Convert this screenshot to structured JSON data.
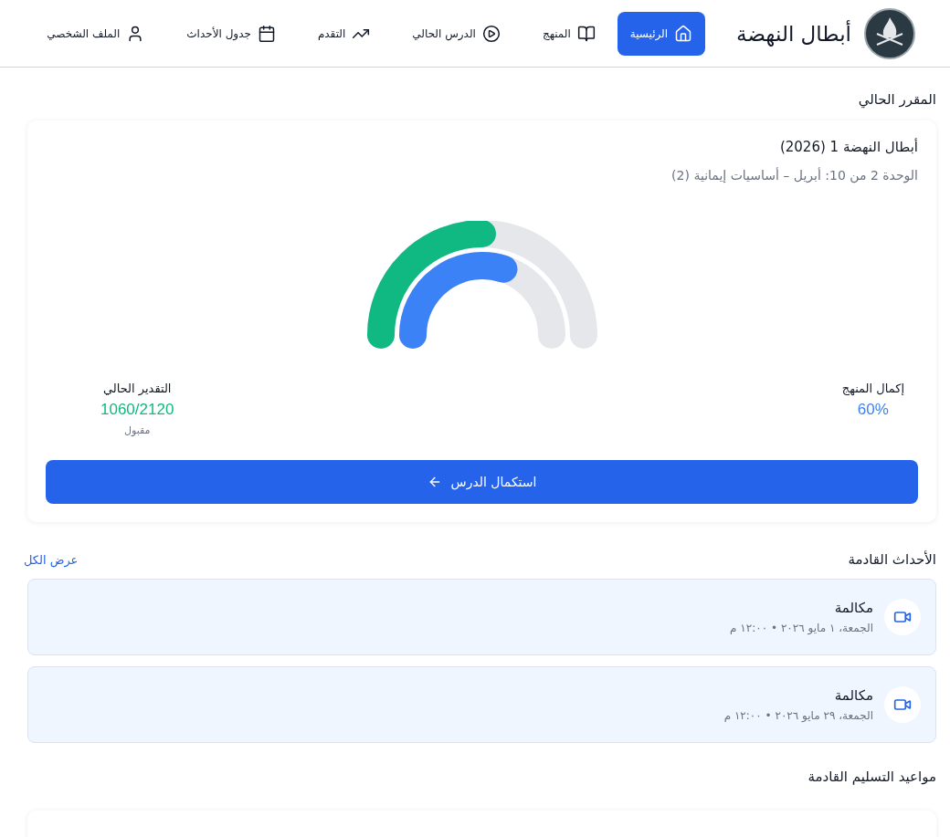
{
  "brand": {
    "name": "أبطال النهضة"
  },
  "nav": [
    {
      "label": "الرئيسية",
      "selected": true
    },
    {
      "label": "المنهج",
      "selected": false
    },
    {
      "label": "الدرس الحالي",
      "selected": false
    },
    {
      "label": "التقدم",
      "selected": false
    },
    {
      "label": "جدول الأحداث",
      "selected": false
    },
    {
      "label": "الملف الشخصي",
      "selected": false
    }
  ],
  "current_course": {
    "heading": "المقرر الحالي",
    "title": "أبطال النهضة 1 (2026)",
    "unit": "الوحدة 2 من 10: أبريل – أساسيات إيمانية (2)",
    "grade_gauge": {
      "level": 0.5
    },
    "completion_gauge": {
      "level": 0.6
    },
    "completion": {
      "label": "إكمال المنهج",
      "value": "60%"
    },
    "grade": {
      "label": "التقدير الحالي",
      "value": "1060/2120",
      "rating": "مقبول"
    },
    "continue_button": "استكمال الدرس"
  },
  "events": {
    "heading": "الأحداث القادمة",
    "view_all": "عرض الكل",
    "items": [
      {
        "title": "مكالمة",
        "when": "الجمعة، ١ مايو ٢٠٢٦ • ١٢:٠٠ م"
      },
      {
        "title": "مكالمة",
        "when": "الجمعة، ٢٩ مايو ٢٠٢٦ • ١٢:٠٠ م"
      }
    ]
  },
  "deadlines": {
    "heading": "مواعيد التسليم القادمة"
  }
}
